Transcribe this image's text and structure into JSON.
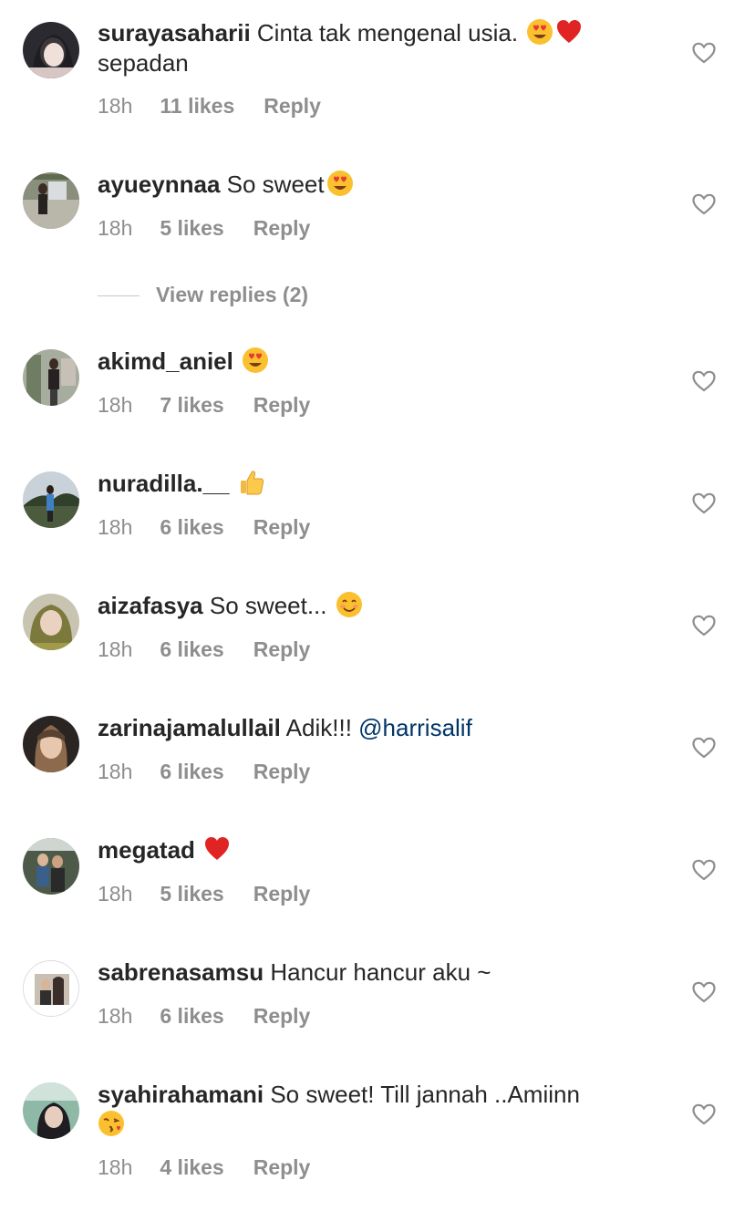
{
  "comments": [
    {
      "username": "surayasaharii",
      "text": "Cinta tak mengenal usia.",
      "emojis": [
        "heart-eyes",
        "red-heart"
      ],
      "text2": "sepadan",
      "time": "18h",
      "likes": "11 likes",
      "reply": "Reply"
    },
    {
      "username": "ayueynnaa",
      "text": "So sweet",
      "emojis": [
        "heart-eyes"
      ],
      "time": "18h",
      "likes": "5 likes",
      "reply": "Reply"
    },
    {
      "username": "akimd_aniel",
      "text": "",
      "emojis": [
        "heart-eyes"
      ],
      "time": "18h",
      "likes": "7 likes",
      "reply": "Reply"
    },
    {
      "username": "nuradilla.__",
      "text": "",
      "emojis": [
        "thumbs-up"
      ],
      "time": "18h",
      "likes": "6 likes",
      "reply": "Reply"
    },
    {
      "username": "aizafasya",
      "text": "So sweet...",
      "emojis": [
        "smiling-face"
      ],
      "time": "18h",
      "likes": "6 likes",
      "reply": "Reply"
    },
    {
      "username": "zarinajamalullail",
      "text": "Adik!!!",
      "mention": "@harrisalif",
      "time": "18h",
      "likes": "6 likes",
      "reply": "Reply"
    },
    {
      "username": "megatad",
      "text": "",
      "emojis": [
        "red-heart"
      ],
      "time": "18h",
      "likes": "5 likes",
      "reply": "Reply"
    },
    {
      "username": "sabrenasamsu",
      "text": "Hancur hancur aku ~",
      "time": "18h",
      "likes": "6 likes",
      "reply": "Reply"
    },
    {
      "username": "syahirahamani",
      "text": "So sweet! Till jannah ..Amiinn",
      "emojis": [
        "face-blowing-kiss"
      ],
      "time": "18h",
      "likes": "4 likes",
      "reply": "Reply"
    }
  ],
  "view_replies_label": "View replies (2)",
  "colors": {
    "text": "#262626",
    "meta": "#8e8e8e",
    "mention": "#003569"
  },
  "icons": {
    "like": "heart-outline-icon"
  }
}
